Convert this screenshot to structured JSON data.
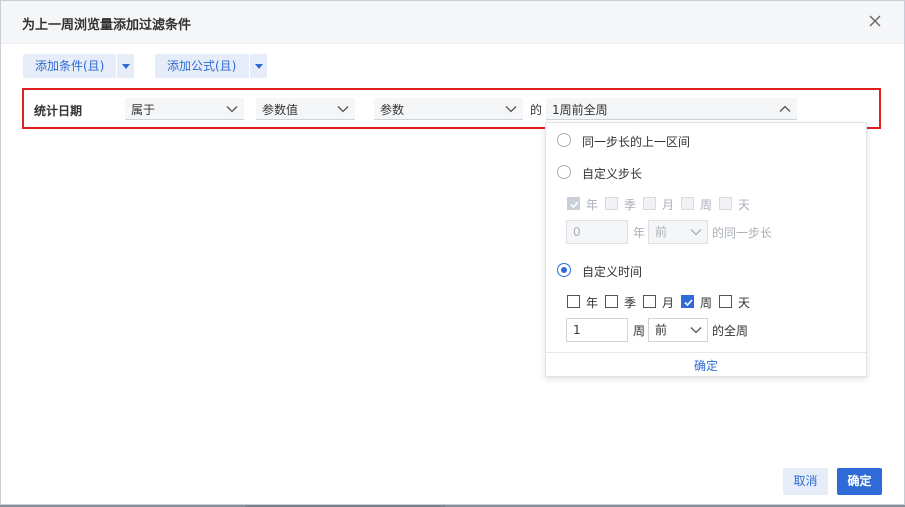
{
  "dialog": {
    "title": "为上一周浏览量添加过滤条件",
    "close_icon": "close-icon"
  },
  "toolbar": {
    "add_condition_label": "添加条件(且)",
    "add_formula_label": "添加公式(且)"
  },
  "condition": {
    "field_label": "统计日期",
    "operator": "属于",
    "value_type": "参数值",
    "param": "参数",
    "connector": "的",
    "range_value": "1周前全周"
  },
  "popup": {
    "option_same_step": "同一步长的上一区间",
    "option_custom_step": "自定义步长",
    "custom_step": {
      "units": [
        "年",
        "季",
        "月",
        "周",
        "天"
      ],
      "checked": [
        true,
        false,
        false,
        false,
        false
      ],
      "count_value": "0",
      "count_unit": "年",
      "direction": "前",
      "suffix": "的同一步长"
    },
    "option_custom_time": "自定义时间",
    "custom_time": {
      "units": [
        "年",
        "季",
        "月",
        "周",
        "天"
      ],
      "checked": [
        false,
        false,
        false,
        true,
        false
      ],
      "count_value": "1",
      "count_unit": "周",
      "direction": "前",
      "suffix": "的全周"
    },
    "selected_option": "自定义时间",
    "confirm_label": "确定"
  },
  "footer": {
    "cancel_label": "取消",
    "ok_label": "确定"
  },
  "colors": {
    "accent": "#2f6bd8",
    "highlight_border": "#e02020"
  }
}
